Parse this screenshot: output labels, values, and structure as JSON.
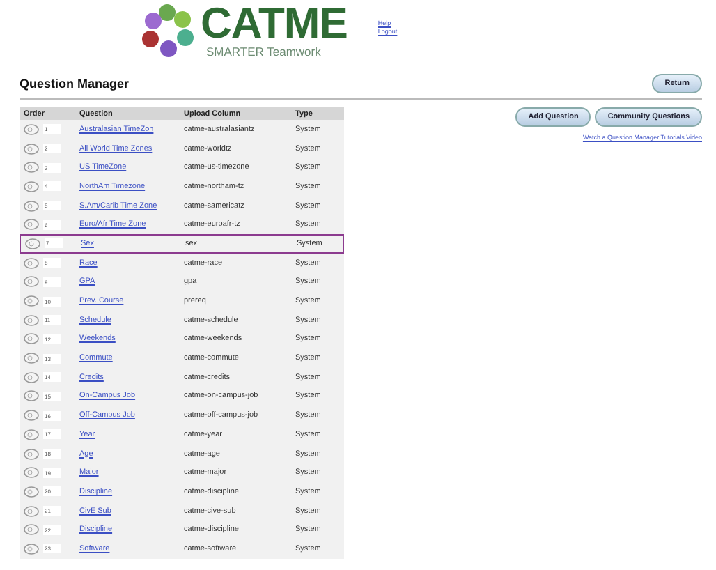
{
  "logo": {
    "title": "CATME",
    "subtitle": "SMARTER Teamwork"
  },
  "top_links": [
    "Help",
    "Logout"
  ],
  "page_title": "Question Manager",
  "return_button": "Return",
  "actions": [
    "Add Question",
    "Community Questions"
  ],
  "tutorial_link": "Watch a Question Manager Tutorials Video",
  "table": {
    "columns": [
      "Order",
      "Question",
      "Upload Column",
      "Type"
    ],
    "rows": [
      {
        "order": "1",
        "question": "Australasian TimeZon",
        "upload_column": "catme-australasiantz",
        "type": "System",
        "highlighted": false
      },
      {
        "order": "2",
        "question": "All World Time Zones",
        "upload_column": "catme-worldtz",
        "type": "System",
        "highlighted": false
      },
      {
        "order": "3",
        "question": "US TimeZone",
        "upload_column": "catme-us-timezone",
        "type": "System",
        "highlighted": false
      },
      {
        "order": "4",
        "question": "NorthAm Timezone",
        "upload_column": "catme-northam-tz",
        "type": "System",
        "highlighted": false
      },
      {
        "order": "5",
        "question": "S.Am/Carib Time Zone",
        "upload_column": "catme-samericatz",
        "type": "System",
        "highlighted": false
      },
      {
        "order": "6",
        "question": "Euro/Afr Time Zone",
        "upload_column": "catme-euroafr-tz",
        "type": "System",
        "highlighted": false
      },
      {
        "order": "7",
        "question": "Sex",
        "upload_column": "sex",
        "type": "System",
        "highlighted": true
      },
      {
        "order": "8",
        "question": "Race",
        "upload_column": "catme-race",
        "type": "System",
        "highlighted": false
      },
      {
        "order": "9",
        "question": "GPA",
        "upload_column": "gpa",
        "type": "System",
        "highlighted": false
      },
      {
        "order": "10",
        "question": "Prev. Course",
        "upload_column": "prereq",
        "type": "System",
        "highlighted": false
      },
      {
        "order": "11",
        "question": "Schedule",
        "upload_column": "catme-schedule",
        "type": "System",
        "highlighted": false
      },
      {
        "order": "12",
        "question": "Weekends",
        "upload_column": "catme-weekends",
        "type": "System",
        "highlighted": false
      },
      {
        "order": "13",
        "question": "Commute",
        "upload_column": "catme-commute",
        "type": "System",
        "highlighted": false
      },
      {
        "order": "14",
        "question": "Credits",
        "upload_column": "catme-credits",
        "type": "System",
        "highlighted": false
      },
      {
        "order": "15",
        "question": "On-Campus Job",
        "upload_column": "catme-on-campus-job",
        "type": "System",
        "highlighted": false
      },
      {
        "order": "16",
        "question": "Off-Campus Job",
        "upload_column": "catme-off-campus-job",
        "type": "System",
        "highlighted": false
      },
      {
        "order": "17",
        "question": "Year",
        "upload_column": "catme-year",
        "type": "System",
        "highlighted": false
      },
      {
        "order": "18",
        "question": "Age",
        "upload_column": "catme-age",
        "type": "System",
        "highlighted": false
      },
      {
        "order": "19",
        "question": "Major",
        "upload_column": "catme-major",
        "type": "System",
        "highlighted": false
      },
      {
        "order": "20",
        "question": "Discipline",
        "upload_column": "catme-discipline",
        "type": "System",
        "highlighted": false
      },
      {
        "order": "21",
        "question": "CivE Sub",
        "upload_column": "catme-cive-sub",
        "type": "System",
        "highlighted": false
      },
      {
        "order": "22",
        "question": "Discipline",
        "upload_column": "catme-discipline",
        "type": "System",
        "highlighted": false
      },
      {
        "order": "23",
        "question": "Software",
        "upload_column": "catme-software",
        "type": "System",
        "highlighted": false
      }
    ]
  }
}
